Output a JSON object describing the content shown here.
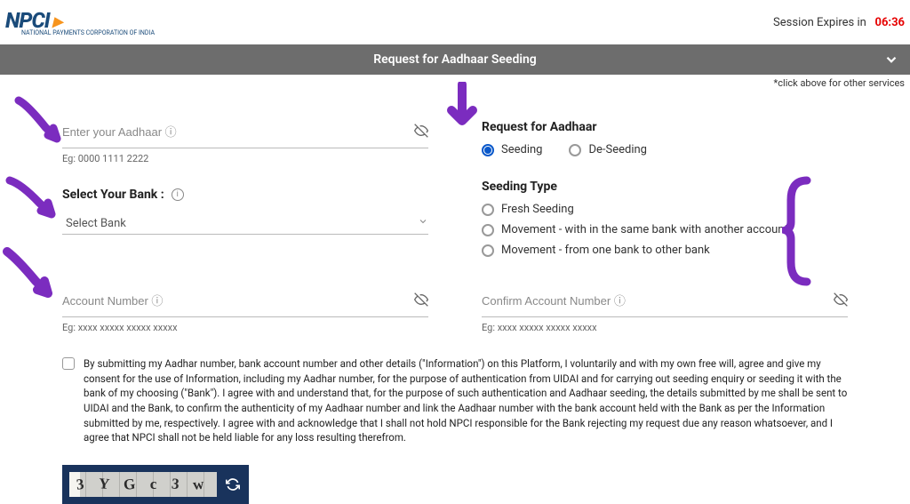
{
  "header": {
    "logo_text": "NPCI",
    "logo_tagline": "NATIONAL PAYMENTS CORPORATION OF INDIA",
    "session_label": "Session Expires in",
    "session_time": "06:36"
  },
  "banner": {
    "title": "Request for Aadhaar Seeding",
    "hint": "*click above for other services"
  },
  "aadhaar": {
    "placeholder": "Enter your Aadhaar ⓘ",
    "example": "Eg: 0000 1111 2222"
  },
  "request": {
    "label": "Request for Aadhaar",
    "options": [
      "Seeding",
      "De-Seeding"
    ],
    "selected": "Seeding"
  },
  "bank": {
    "label": "Select Your Bank :",
    "placeholder": "Select Bank"
  },
  "seeding_type": {
    "label": "Seeding Type",
    "options": [
      "Fresh Seeding",
      "Movement - with in the same bank with another account",
      "Movement - from one bank to other bank"
    ]
  },
  "account": {
    "placeholder": "Account Number ⓘ",
    "example": "Eg: xxxx xxxxx xxxxx xxxxx"
  },
  "confirm_account": {
    "placeholder": "Confirm Account Number ⓘ",
    "example": "Eg: xxxx xxxxx xxxxx xxxxx"
  },
  "consent": {
    "text": "By submitting my Aadhar number, bank account number and other details (\"Information\") on this Platform, I voluntarily and with my own free will, agree and give my consent for the use of Information, including my Aadhar number, for the purpose of authentication from UIDAI and for carrying out seeding enquiry or seeding it with the bank of my choosing (\"Bank\"). I agree with and understand that, for the purpose of such authentication and Aadhaar seeding, the details submitted by me shall be sent to UIDAI and the Bank, to confirm the authenticity of my Aadhaar number and link the Aadhaar number with the bank account held with the Bank as per the Information submitted by me, respectively. I agree with and acknowledge that I shall not hold NPCI responsible for the Bank rejecting my request due any reason whatsoever, and I agree that NPCI shall not be held liable for any loss resulting therefrom."
  },
  "captcha": {
    "chars": [
      "3",
      "Y",
      "G",
      "c",
      "3",
      "w"
    ]
  }
}
